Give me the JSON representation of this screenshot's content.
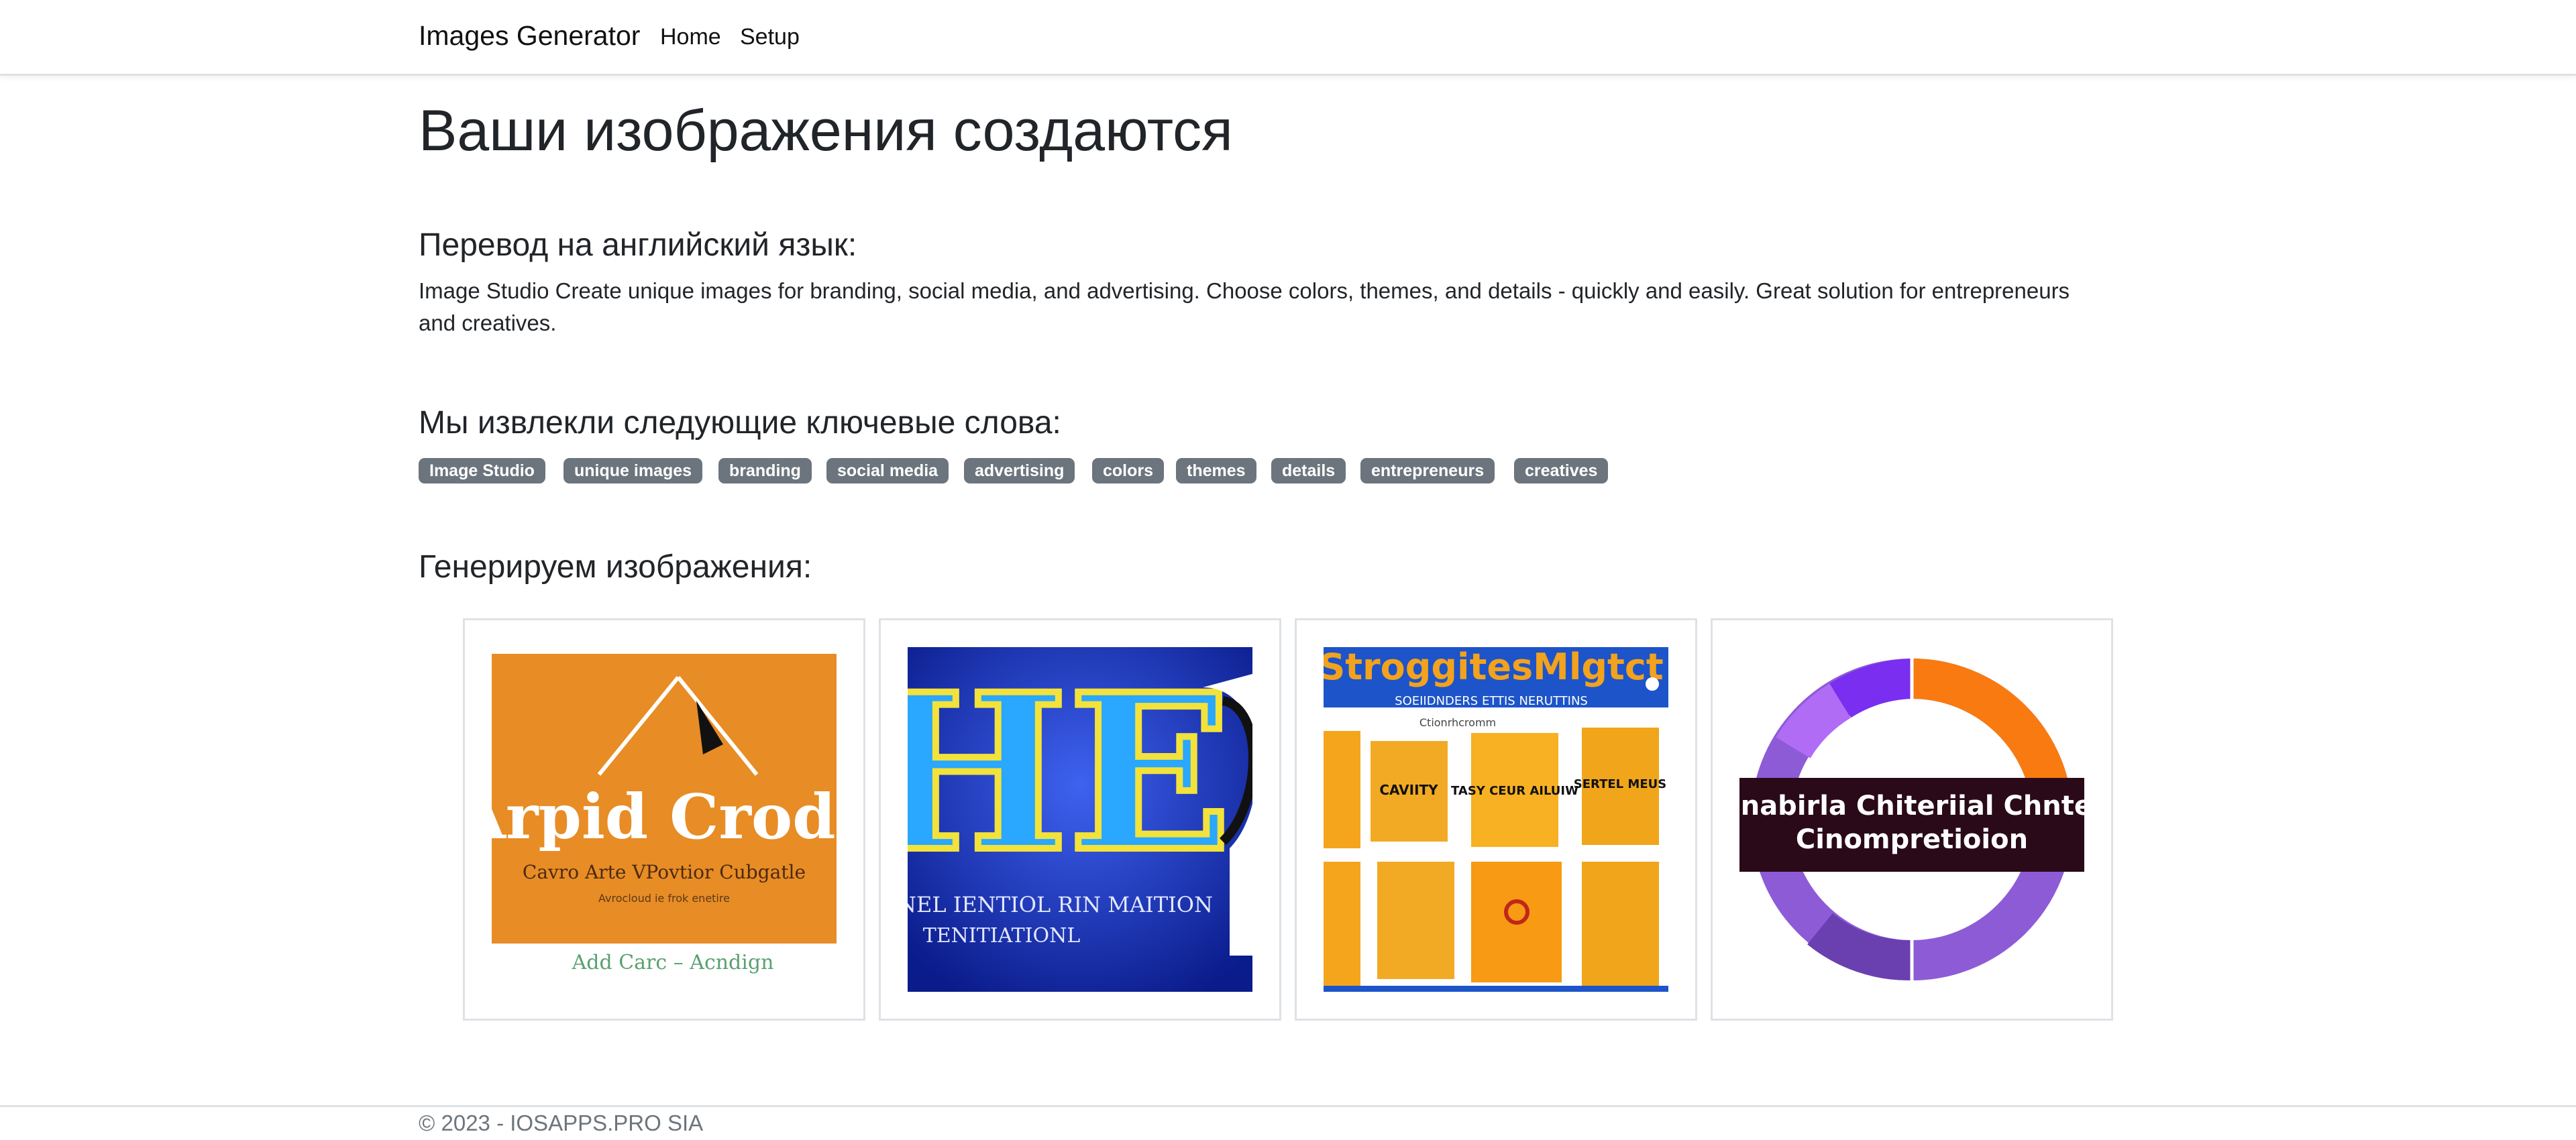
{
  "navbar": {
    "brand": "Images Generator",
    "links": [
      "Home",
      "Setup"
    ]
  },
  "main": {
    "title": "Ваши изображения создаются",
    "translation_heading": "Перевод на английский язык:",
    "translation_text": "Image Studio Create unique images for branding, social media, and advertising. Choose colors, themes, and details - quickly and easily. Great solution for entrepreneurs and creatives.",
    "keywords_heading": "Мы извлекли следующие ключевые слова:",
    "keywords": [
      "Image Studio",
      "unique images",
      "branding",
      "social media",
      "advertising",
      "colors",
      "themes",
      "details",
      "entrepreneurs",
      "creatives"
    ],
    "generate_heading": "Генерируем изображения:",
    "images": [
      {
        "alt": "generated-image-1",
        "text_big": "Arpid Crods",
        "text_small": "Cavro Arte VPovtior Cubgatle",
        "text_tiny": "Avrocloud ie frok enetire",
        "text_caption": "Add Carc – Acndign"
      },
      {
        "alt": "generated-image-2",
        "text_big": "HE",
        "text_small": "NEL IENTIOL RIN MAITION",
        "text_tiny": "TENITIATIONL"
      },
      {
        "alt": "generated-image-3",
        "text_big": "StroggitesMlgtct",
        "text_small": "SOEIIDNDERS ETTIS NERUTTINS",
        "text_tiny": "Ctionrhcromm",
        "text_tiles": [
          "CAVIITY",
          "TASY CEUR AILUIW",
          "SERTEL MEUS"
        ]
      },
      {
        "alt": "generated-image-4",
        "text_big": "inabirla Chiteriial Chnte",
        "text_small": "Cinompretioion"
      }
    ]
  },
  "footer": {
    "text": "© 2023 - IOSAPPS.PRO SIA"
  },
  "colors": {
    "badge_bg": "#6c757d",
    "border": "#dee2e6",
    "text": "#212529"
  }
}
